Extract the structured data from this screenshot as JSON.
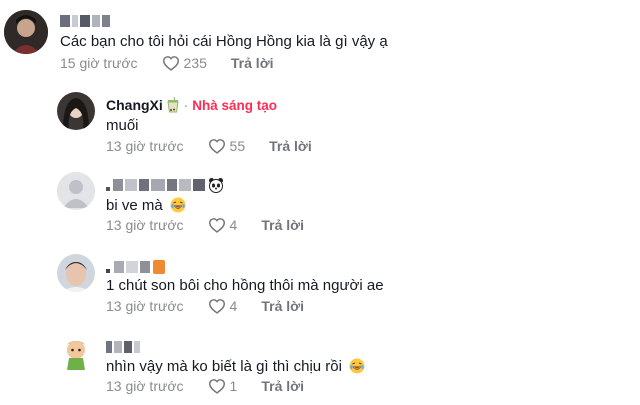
{
  "comments": [
    {
      "username": "",
      "text": "Các bạn cho tôi hỏi cái Hồng Hồng kia là gì vậy ạ",
      "time": "15 giờ trước",
      "likes": "235",
      "reply": "Trả lời"
    },
    {
      "username": "ChangXi",
      "creator_label": "Nhà sáng tạo",
      "separator": "·",
      "text": "muối",
      "time": "13 giờ trước",
      "likes": "55",
      "reply": "Trả lời"
    },
    {
      "username": "",
      "text": "bi ve mà",
      "time": "13 giờ trước",
      "likes": "4",
      "reply": "Trả lời"
    },
    {
      "username": "",
      "text": "1 chút son bôi cho hồng thôi mà người ae",
      "time": "13 giờ trước",
      "likes": "4",
      "reply": "Trả lời"
    },
    {
      "username": "",
      "text": "nhìn vậy mà ko biết là gì thì chịu rồi",
      "time": "13 giờ trước",
      "likes": "1",
      "reply": "Trả lời"
    }
  ],
  "icons": {
    "like": "heart-outline-icon",
    "laugh": "laughing-emoji-icon",
    "panda": "panda-emoji-icon",
    "tea": "bubble-tea-emoji-icon"
  },
  "colors": {
    "creator_label": "#fe2c55",
    "meta_text": "#8a8b91",
    "primary_text": "#161823"
  }
}
